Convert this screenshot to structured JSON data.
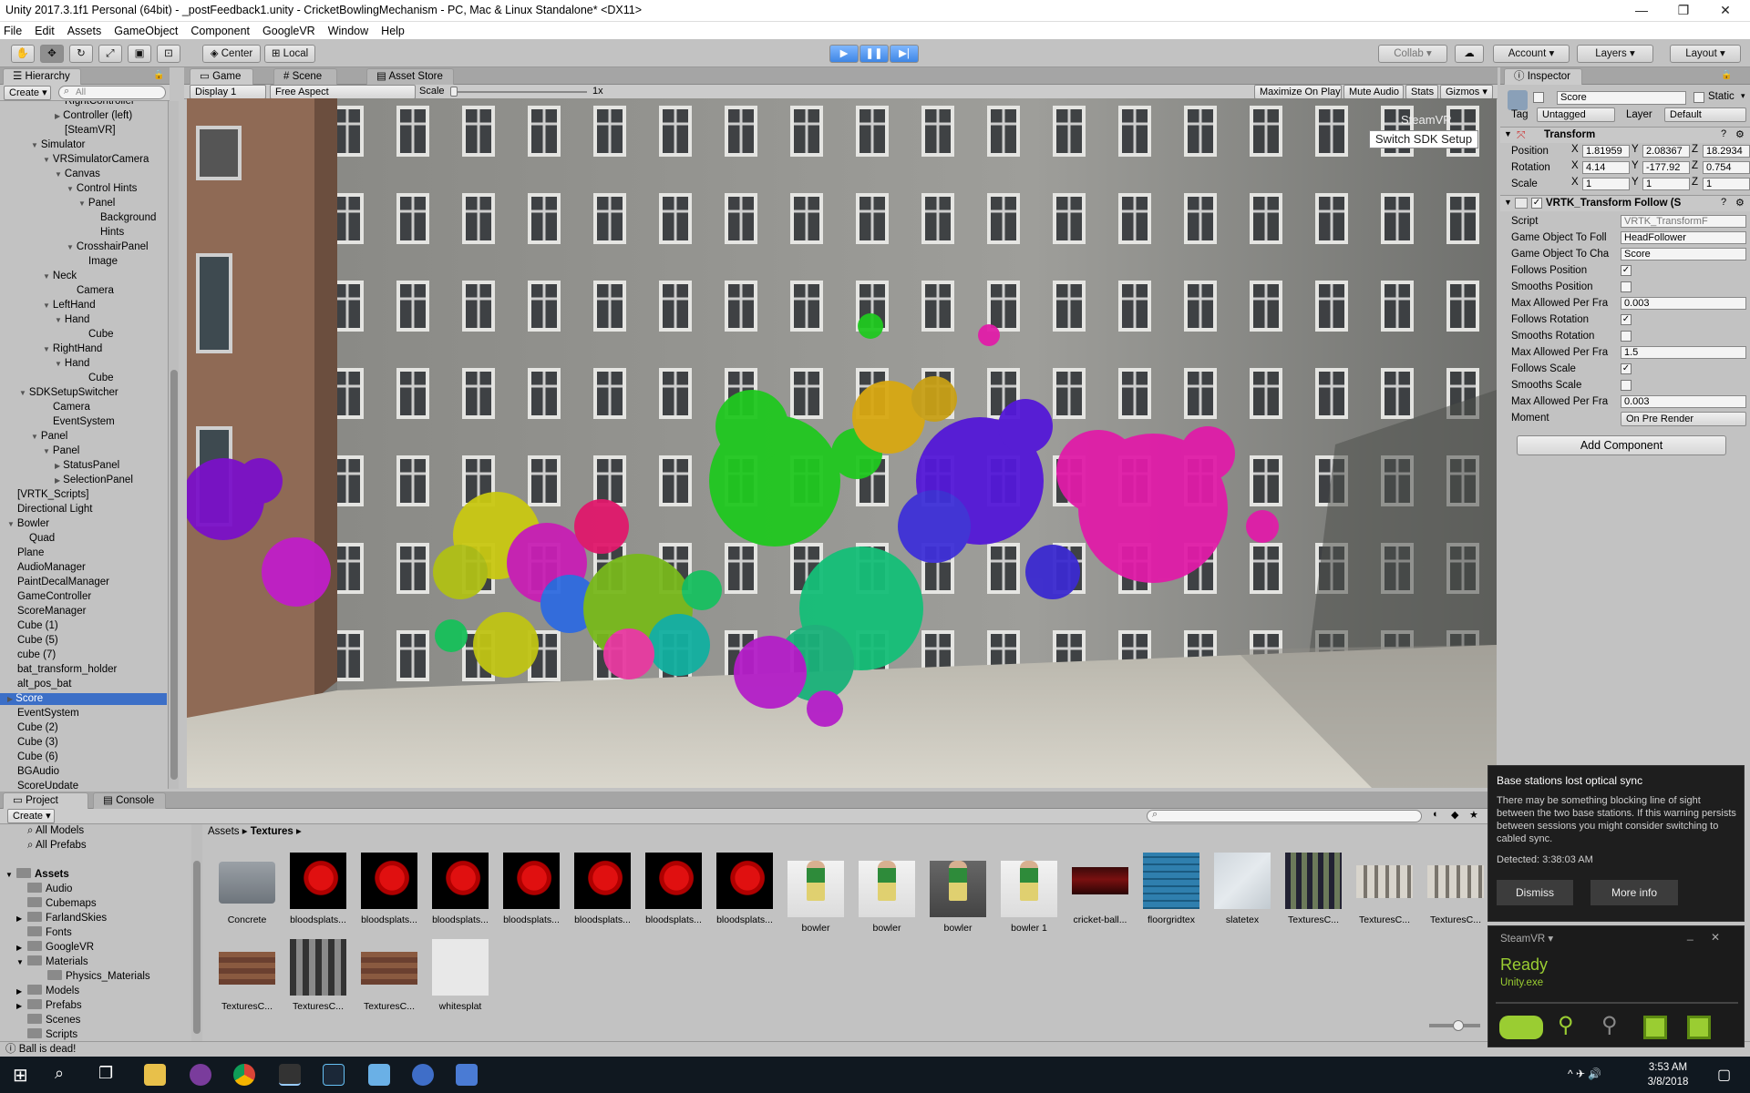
{
  "window": {
    "title": "Unity 2017.3.1f1 Personal (64bit) - _postFeedback1.unity - CricketBowlingMechanism - PC, Mac & Linux Standalone* <DX11>",
    "minimize": "—",
    "maximize": "❐",
    "close": "✕"
  },
  "menu": [
    "File",
    "Edit",
    "Assets",
    "GameObject",
    "Component",
    "GoogleVR",
    "Window",
    "Help"
  ],
  "toolbar": {
    "center": "Center",
    "local": "Local",
    "collab": "Collab ▾",
    "account": "Account",
    "layers": "Layers",
    "layout": "Layout"
  },
  "hierarchy": {
    "tab": "Hierarchy",
    "create": "Create",
    "search_placeholder": "All",
    "items": [
      {
        "label": "RightController",
        "indent": 4,
        "arrow": ""
      },
      {
        "label": "Controller (left)",
        "indent": 4,
        "arrow": "▶"
      },
      {
        "label": "[SteamVR]",
        "indent": 4,
        "arrow": ""
      },
      {
        "label": "Simulator",
        "indent": 2,
        "arrow": "▼"
      },
      {
        "label": "VRSimulatorCamera",
        "indent": 3,
        "arrow": "▼"
      },
      {
        "label": "Canvas",
        "indent": 4,
        "arrow": "▼"
      },
      {
        "label": "Control Hints",
        "indent": 5,
        "arrow": "▼"
      },
      {
        "label": "Panel",
        "indent": 6,
        "arrow": "▼"
      },
      {
        "label": "Background",
        "indent": 7,
        "arrow": ""
      },
      {
        "label": "Hints",
        "indent": 7,
        "arrow": ""
      },
      {
        "label": "CrosshairPanel",
        "indent": 5,
        "arrow": "▼"
      },
      {
        "label": "Image",
        "indent": 6,
        "arrow": ""
      },
      {
        "label": "Neck",
        "indent": 3,
        "arrow": "▼"
      },
      {
        "label": "Camera",
        "indent": 5,
        "arrow": ""
      },
      {
        "label": "LeftHand",
        "indent": 3,
        "arrow": "▼"
      },
      {
        "label": "Hand",
        "indent": 4,
        "arrow": "▼"
      },
      {
        "label": "Cube",
        "indent": 6,
        "arrow": ""
      },
      {
        "label": "RightHand",
        "indent": 3,
        "arrow": "▼"
      },
      {
        "label": "Hand",
        "indent": 4,
        "arrow": "▼"
      },
      {
        "label": "Cube",
        "indent": 6,
        "arrow": ""
      },
      {
        "label": "SDKSetupSwitcher",
        "indent": 1,
        "arrow": "▼"
      },
      {
        "label": "Camera",
        "indent": 3,
        "arrow": ""
      },
      {
        "label": "EventSystem",
        "indent": 3,
        "arrow": ""
      },
      {
        "label": "Panel",
        "indent": 2,
        "arrow": "▼"
      },
      {
        "label": "Panel",
        "indent": 3,
        "arrow": "▼"
      },
      {
        "label": "StatusPanel",
        "indent": 4,
        "arrow": "▶"
      },
      {
        "label": "SelectionPanel",
        "indent": 4,
        "arrow": "▶"
      },
      {
        "label": "[VRTK_Scripts]",
        "indent": 0,
        "arrow": ""
      },
      {
        "label": "Directional Light",
        "indent": 0,
        "arrow": ""
      },
      {
        "label": "Bowler",
        "indent": 0,
        "arrow": "▼"
      },
      {
        "label": "Quad",
        "indent": 1,
        "arrow": ""
      },
      {
        "label": "Plane",
        "indent": 0,
        "arrow": ""
      },
      {
        "label": "AudioManager",
        "indent": 0,
        "arrow": ""
      },
      {
        "label": "PaintDecalManager",
        "indent": 0,
        "arrow": ""
      },
      {
        "label": "GameController",
        "indent": 0,
        "arrow": ""
      },
      {
        "label": "ScoreManager",
        "indent": 0,
        "arrow": ""
      },
      {
        "label": "Cube (1)",
        "indent": 0,
        "arrow": ""
      },
      {
        "label": "Cube (5)",
        "indent": 0,
        "arrow": ""
      },
      {
        "label": "cube (7)",
        "indent": 0,
        "arrow": ""
      },
      {
        "label": "bat_transform_holder",
        "indent": 0,
        "arrow": ""
      },
      {
        "label": "alt_pos_bat",
        "indent": 0,
        "arrow": ""
      },
      {
        "label": "Score",
        "indent": 0,
        "arrow": "▶",
        "selected": true
      },
      {
        "label": "EventSystem",
        "indent": 0,
        "arrow": ""
      },
      {
        "label": "Cube (2)",
        "indent": 0,
        "arrow": ""
      },
      {
        "label": "Cube (3)",
        "indent": 0,
        "arrow": ""
      },
      {
        "label": "Cube (6)",
        "indent": 0,
        "arrow": ""
      },
      {
        "label": "BGAudio",
        "indent": 0,
        "arrow": ""
      },
      {
        "label": "ScoreUpdate",
        "indent": 0,
        "arrow": ""
      }
    ]
  },
  "gameview": {
    "tab_game": "Game",
    "tab_scene": "Scene",
    "tab_store": "Asset Store",
    "display": "Display 1",
    "aspect": "Free Aspect",
    "scale_label": "Scale",
    "scale_value": "1x",
    "maximize": "Maximize On Play",
    "mute": "Mute Audio",
    "stats": "Stats",
    "gizmos": "Gizmos",
    "steamvr_label": "SteamVR",
    "switch_sdk": "Switch SDK Setup"
  },
  "inspector": {
    "tab": "Inspector",
    "object_name": "Score",
    "static": "Static",
    "tag_label": "Tag",
    "tag": "Untagged",
    "layer_label": "Layer",
    "layer": "Default",
    "transform": {
      "title": "Transform",
      "position_label": "Position",
      "rotation_label": "Rotation",
      "scale_label": "Scale",
      "pos": [
        "1.81959",
        "2.08367",
        "18.2934"
      ],
      "rot": [
        "4.14",
        "-177.92",
        "0.754"
      ],
      "scl": [
        "1",
        "1",
        "1"
      ]
    },
    "vrtk": {
      "title": "VRTK_Transform Follow (S",
      "rows": [
        {
          "label": "Script",
          "value": "VRTK_TransformF",
          "type": "field"
        },
        {
          "label": "Game Object To Foll",
          "value": "HeadFollower",
          "type": "field"
        },
        {
          "label": "Game Object To Cha",
          "value": "Score",
          "type": "field"
        },
        {
          "label": "Follows Position",
          "value": "✓",
          "type": "check"
        },
        {
          "label": "Smooths Position",
          "value": "",
          "type": "check"
        },
        {
          "label": "Max Allowed Per Fra",
          "value": "0.003",
          "type": "field"
        },
        {
          "label": "Follows Rotation",
          "value": "✓",
          "type": "check"
        },
        {
          "label": "Smooths Rotation",
          "value": "",
          "type": "check"
        },
        {
          "label": "Max Allowed Per Fra",
          "value": "1.5",
          "type": "field"
        },
        {
          "label": "Follows Scale",
          "value": "✓",
          "type": "check"
        },
        {
          "label": "Smooths Scale",
          "value": "",
          "type": "check"
        },
        {
          "label": "Max Allowed Per Fra",
          "value": "0.003",
          "type": "field"
        },
        {
          "label": "Moment",
          "value": "On Pre Render",
          "type": "dropdown"
        }
      ]
    },
    "add_component": "Add Component"
  },
  "project": {
    "tab_project": "Project",
    "tab_console": "Console",
    "create": "Create",
    "favorites": [
      "All Models",
      "All Prefabs"
    ],
    "tree": [
      {
        "label": "Assets",
        "bold": true,
        "arrow": "▼"
      },
      {
        "label": "Audio",
        "arrow": ""
      },
      {
        "label": "Cubemaps",
        "arrow": ""
      },
      {
        "label": "FarlandSkies",
        "arrow": "▶"
      },
      {
        "label": "Fonts",
        "arrow": ""
      },
      {
        "label": "GoogleVR",
        "arrow": "▶"
      },
      {
        "label": "Materials",
        "arrow": "▼"
      },
      {
        "label": "Physics_Materials",
        "arrow": "",
        "sub": true
      },
      {
        "label": "Models",
        "arrow": "▶"
      },
      {
        "label": "Prefabs",
        "arrow": "▶"
      },
      {
        "label": "Scenes",
        "arrow": ""
      },
      {
        "label": "Scripts",
        "arrow": ""
      }
    ],
    "breadcrumb_root": "Assets",
    "breadcrumb_current": "Textures",
    "assets": [
      {
        "label": "Concrete",
        "kind": "folder"
      },
      {
        "label": "bloodsplats...",
        "kind": "splat"
      },
      {
        "label": "bloodsplats...",
        "kind": "splat"
      },
      {
        "label": "bloodsplats...",
        "kind": "splat"
      },
      {
        "label": "bloodsplats...",
        "kind": "splat"
      },
      {
        "label": "bloodsplats...",
        "kind": "splat"
      },
      {
        "label": "bloodsplats...",
        "kind": "splat"
      },
      {
        "label": "bloodsplats...",
        "kind": "splat"
      },
      {
        "label": "bowler",
        "kind": "bowler"
      },
      {
        "label": "bowler",
        "kind": "bowler"
      },
      {
        "label": "bowler",
        "kind": "bowlerdark"
      },
      {
        "label": "bowler 1",
        "kind": "bowler"
      },
      {
        "label": "cricket-ball...",
        "kind": "ball"
      },
      {
        "label": "floorgridtex",
        "kind": "grid"
      },
      {
        "label": "slatetex",
        "kind": "slate"
      },
      {
        "label": "TexturesC...",
        "kind": "building"
      },
      {
        "label": "TexturesC...",
        "kind": "facade"
      },
      {
        "label": "TexturesC...",
        "kind": "facade"
      },
      {
        "label": "TexturesC...",
        "kind": "brick"
      },
      {
        "label": "TexturesC...",
        "kind": "building2"
      },
      {
        "label": "TexturesC...",
        "kind": "brick"
      },
      {
        "label": "whitesplat",
        "kind": "white"
      }
    ]
  },
  "statusbar": "Ball is dead!",
  "notification": {
    "title": "Base stations lost optical sync",
    "body": "There may be something blocking line of sight between the two base stations. If this warning persists between sessions you might consider switching to cabled sync.",
    "detected": "Detected: 3:38:03 AM",
    "dismiss": "Dismiss",
    "more": "More info"
  },
  "steamvr": {
    "title": "SteamVR ▾",
    "status": "Ready",
    "app": "Unity.exe"
  },
  "taskbar": {
    "time": "3:53 AM",
    "date": "3/8/2018"
  },
  "colors": {
    "selection": "#3c6fc7",
    "steamvr_green": "#9acd32"
  }
}
